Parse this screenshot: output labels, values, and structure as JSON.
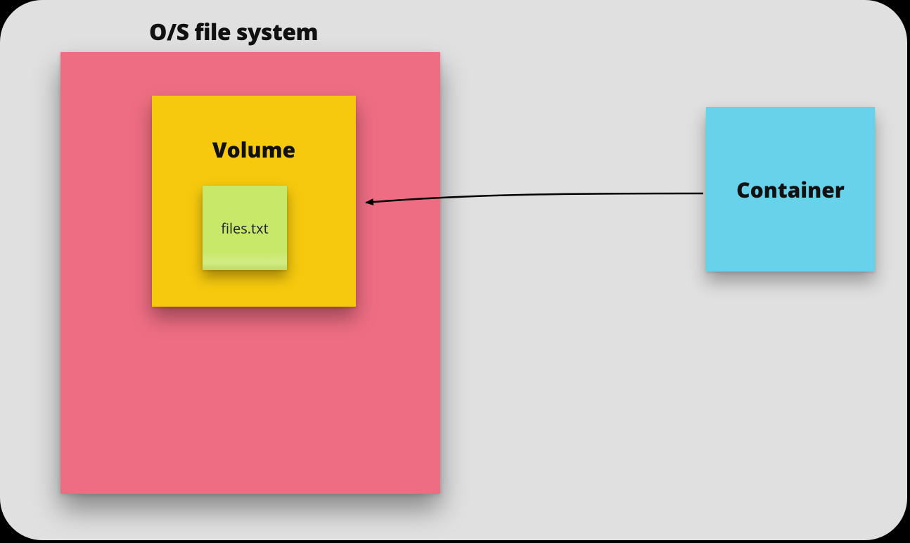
{
  "diagram": {
    "title": "O/S file system",
    "filesystem": {
      "volume": {
        "label": "Volume",
        "file": {
          "label": "files.txt"
        }
      }
    },
    "container": {
      "label": "Container"
    },
    "arrow": {
      "from": "container",
      "to": "volume"
    }
  }
}
